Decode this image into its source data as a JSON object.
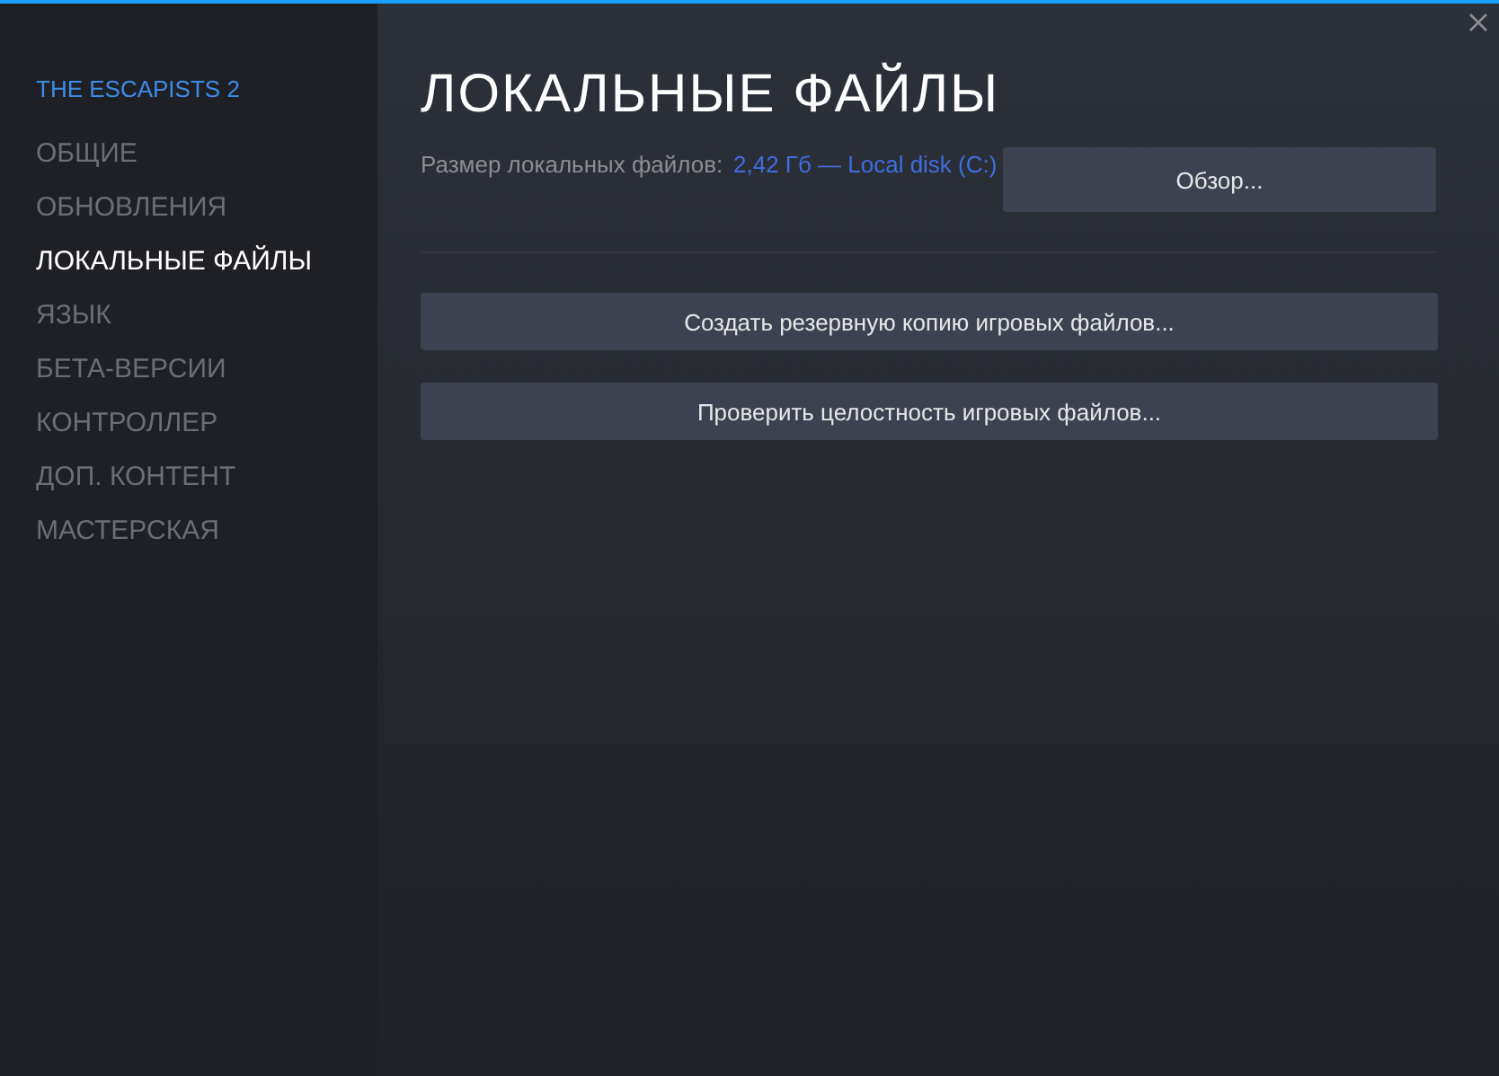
{
  "sidebar": {
    "game_title": "THE ESCAPISTS 2",
    "items": [
      {
        "label": "ОБЩИЕ",
        "selected": false
      },
      {
        "label": "ОБНОВЛЕНИЯ",
        "selected": false
      },
      {
        "label": "ЛОКАЛЬНЫЕ ФАЙЛЫ",
        "selected": true
      },
      {
        "label": "ЯЗЫК",
        "selected": false
      },
      {
        "label": "БЕТА-ВЕРСИИ",
        "selected": false
      },
      {
        "label": "КОНТРОЛЛЕР",
        "selected": false
      },
      {
        "label": "ДОП. КОНТЕНТ",
        "selected": false
      },
      {
        "label": "МАСТЕРСКАЯ",
        "selected": false
      }
    ]
  },
  "content": {
    "title": "ЛОКАЛЬНЫЕ ФАЙЛЫ",
    "size_label": "Размер локальных файлов:",
    "size_value": "2,42 Гб — Local disk (C:)",
    "browse_button": "Обзор...",
    "actions": [
      "Создать резервную копию игровых файлов...",
      "Проверить целостность игровых файлов..."
    ]
  }
}
